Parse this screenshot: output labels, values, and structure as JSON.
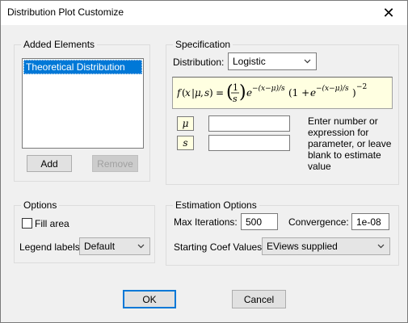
{
  "window": {
    "title": "Distribution Plot Customize",
    "close_glyph": "✕"
  },
  "added_elements": {
    "group_label": "Added Elements",
    "items": [
      "Theoretical Distribution"
    ],
    "add_label": "Add",
    "remove_label": "Remove"
  },
  "specification": {
    "group_label": "Specification",
    "distribution_label": "Distribution:",
    "distribution_value": "Logistic",
    "params": [
      {
        "symbol": "μ",
        "value": ""
      },
      {
        "symbol": "s",
        "value": ""
      }
    ],
    "hint": "Enter number or expression for parameter, or leave blank to estimate value"
  },
  "options": {
    "group_label": "Options",
    "fill_area_label": "Fill area",
    "fill_area_checked": false,
    "legend_labels_label": "Legend labels:",
    "legend_labels_value": "Default"
  },
  "estimation": {
    "group_label": "Estimation Options",
    "max_iterations_label": "Max Iterations:",
    "max_iterations_value": "500",
    "convergence_label": "Convergence:",
    "convergence_value": "1e-08",
    "starting_coef_label": "Starting Coef Values:",
    "starting_coef_value": "EViews supplied"
  },
  "footer": {
    "ok_label": "OK",
    "cancel_label": "Cancel"
  }
}
